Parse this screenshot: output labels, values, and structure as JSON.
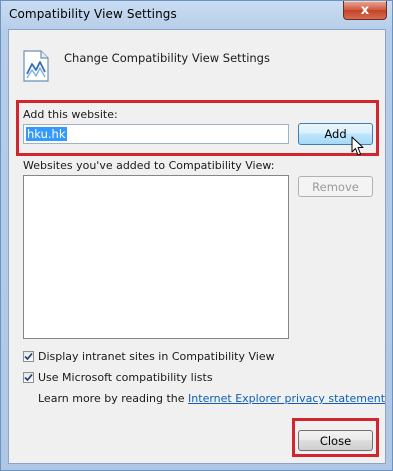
{
  "window": {
    "title": "Compatibility View Settings",
    "close_glyph": "x"
  },
  "header": {
    "icon": "compatibility-view-icon",
    "text": "Change Compatibility View Settings"
  },
  "add_section": {
    "label": "Add this website:",
    "input_value": "hku.hk",
    "add_button": "Add"
  },
  "list_section": {
    "label": "Websites you've added to Compatibility View:",
    "items": [],
    "remove_button": "Remove"
  },
  "options": {
    "intranet": {
      "label": "Display intranet sites in Compatibility View",
      "checked": true
    },
    "ms_lists": {
      "label": "Use Microsoft compatibility lists",
      "checked": true
    }
  },
  "privacy": {
    "prefix": "Learn more by reading the ",
    "link_text": "Internet Explorer privacy statement"
  },
  "footer": {
    "close_button": "Close"
  },
  "colors": {
    "highlight_box": "#d0262f",
    "link": "#0f5fb6",
    "selection": "#3399ff"
  }
}
